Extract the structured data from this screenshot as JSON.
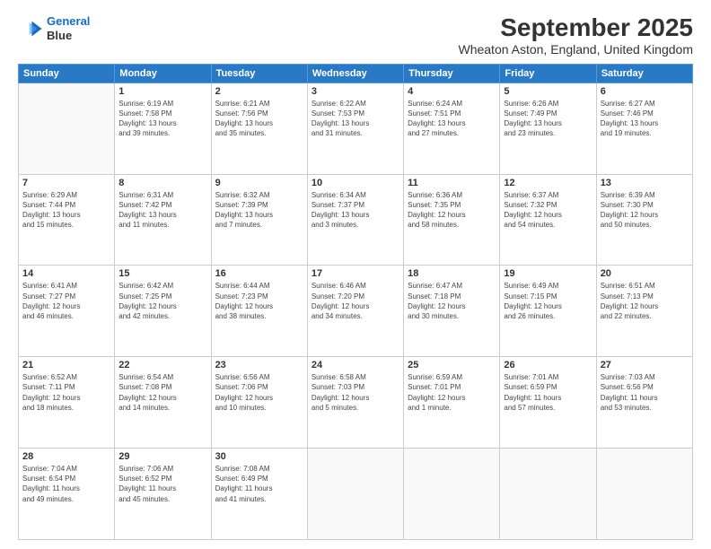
{
  "logo": {
    "line1": "General",
    "line2": "Blue"
  },
  "header": {
    "month": "September 2025",
    "location": "Wheaton Aston, England, United Kingdom"
  },
  "weekdays": [
    "Sunday",
    "Monday",
    "Tuesday",
    "Wednesday",
    "Thursday",
    "Friday",
    "Saturday"
  ],
  "weeks": [
    [
      {
        "day": "",
        "info": ""
      },
      {
        "day": "1",
        "info": "Sunrise: 6:19 AM\nSunset: 7:58 PM\nDaylight: 13 hours\nand 39 minutes."
      },
      {
        "day": "2",
        "info": "Sunrise: 6:21 AM\nSunset: 7:56 PM\nDaylight: 13 hours\nand 35 minutes."
      },
      {
        "day": "3",
        "info": "Sunrise: 6:22 AM\nSunset: 7:53 PM\nDaylight: 13 hours\nand 31 minutes."
      },
      {
        "day": "4",
        "info": "Sunrise: 6:24 AM\nSunset: 7:51 PM\nDaylight: 13 hours\nand 27 minutes."
      },
      {
        "day": "5",
        "info": "Sunrise: 6:26 AM\nSunset: 7:49 PM\nDaylight: 13 hours\nand 23 minutes."
      },
      {
        "day": "6",
        "info": "Sunrise: 6:27 AM\nSunset: 7:46 PM\nDaylight: 13 hours\nand 19 minutes."
      }
    ],
    [
      {
        "day": "7",
        "info": "Sunrise: 6:29 AM\nSunset: 7:44 PM\nDaylight: 13 hours\nand 15 minutes."
      },
      {
        "day": "8",
        "info": "Sunrise: 6:31 AM\nSunset: 7:42 PM\nDaylight: 13 hours\nand 11 minutes."
      },
      {
        "day": "9",
        "info": "Sunrise: 6:32 AM\nSunset: 7:39 PM\nDaylight: 13 hours\nand 7 minutes."
      },
      {
        "day": "10",
        "info": "Sunrise: 6:34 AM\nSunset: 7:37 PM\nDaylight: 13 hours\nand 3 minutes."
      },
      {
        "day": "11",
        "info": "Sunrise: 6:36 AM\nSunset: 7:35 PM\nDaylight: 12 hours\nand 58 minutes."
      },
      {
        "day": "12",
        "info": "Sunrise: 6:37 AM\nSunset: 7:32 PM\nDaylight: 12 hours\nand 54 minutes."
      },
      {
        "day": "13",
        "info": "Sunrise: 6:39 AM\nSunset: 7:30 PM\nDaylight: 12 hours\nand 50 minutes."
      }
    ],
    [
      {
        "day": "14",
        "info": "Sunrise: 6:41 AM\nSunset: 7:27 PM\nDaylight: 12 hours\nand 46 minutes."
      },
      {
        "day": "15",
        "info": "Sunrise: 6:42 AM\nSunset: 7:25 PM\nDaylight: 12 hours\nand 42 minutes."
      },
      {
        "day": "16",
        "info": "Sunrise: 6:44 AM\nSunset: 7:23 PM\nDaylight: 12 hours\nand 38 minutes."
      },
      {
        "day": "17",
        "info": "Sunrise: 6:46 AM\nSunset: 7:20 PM\nDaylight: 12 hours\nand 34 minutes."
      },
      {
        "day": "18",
        "info": "Sunrise: 6:47 AM\nSunset: 7:18 PM\nDaylight: 12 hours\nand 30 minutes."
      },
      {
        "day": "19",
        "info": "Sunrise: 6:49 AM\nSunset: 7:15 PM\nDaylight: 12 hours\nand 26 minutes."
      },
      {
        "day": "20",
        "info": "Sunrise: 6:51 AM\nSunset: 7:13 PM\nDaylight: 12 hours\nand 22 minutes."
      }
    ],
    [
      {
        "day": "21",
        "info": "Sunrise: 6:52 AM\nSunset: 7:11 PM\nDaylight: 12 hours\nand 18 minutes."
      },
      {
        "day": "22",
        "info": "Sunrise: 6:54 AM\nSunset: 7:08 PM\nDaylight: 12 hours\nand 14 minutes."
      },
      {
        "day": "23",
        "info": "Sunrise: 6:56 AM\nSunset: 7:06 PM\nDaylight: 12 hours\nand 10 minutes."
      },
      {
        "day": "24",
        "info": "Sunrise: 6:58 AM\nSunset: 7:03 PM\nDaylight: 12 hours\nand 5 minutes."
      },
      {
        "day": "25",
        "info": "Sunrise: 6:59 AM\nSunset: 7:01 PM\nDaylight: 12 hours\nand 1 minute."
      },
      {
        "day": "26",
        "info": "Sunrise: 7:01 AM\nSunset: 6:59 PM\nDaylight: 11 hours\nand 57 minutes."
      },
      {
        "day": "27",
        "info": "Sunrise: 7:03 AM\nSunset: 6:56 PM\nDaylight: 11 hours\nand 53 minutes."
      }
    ],
    [
      {
        "day": "28",
        "info": "Sunrise: 7:04 AM\nSunset: 6:54 PM\nDaylight: 11 hours\nand 49 minutes."
      },
      {
        "day": "29",
        "info": "Sunrise: 7:06 AM\nSunset: 6:52 PM\nDaylight: 11 hours\nand 45 minutes."
      },
      {
        "day": "30",
        "info": "Sunrise: 7:08 AM\nSunset: 6:49 PM\nDaylight: 11 hours\nand 41 minutes."
      },
      {
        "day": "",
        "info": ""
      },
      {
        "day": "",
        "info": ""
      },
      {
        "day": "",
        "info": ""
      },
      {
        "day": "",
        "info": ""
      }
    ]
  ]
}
